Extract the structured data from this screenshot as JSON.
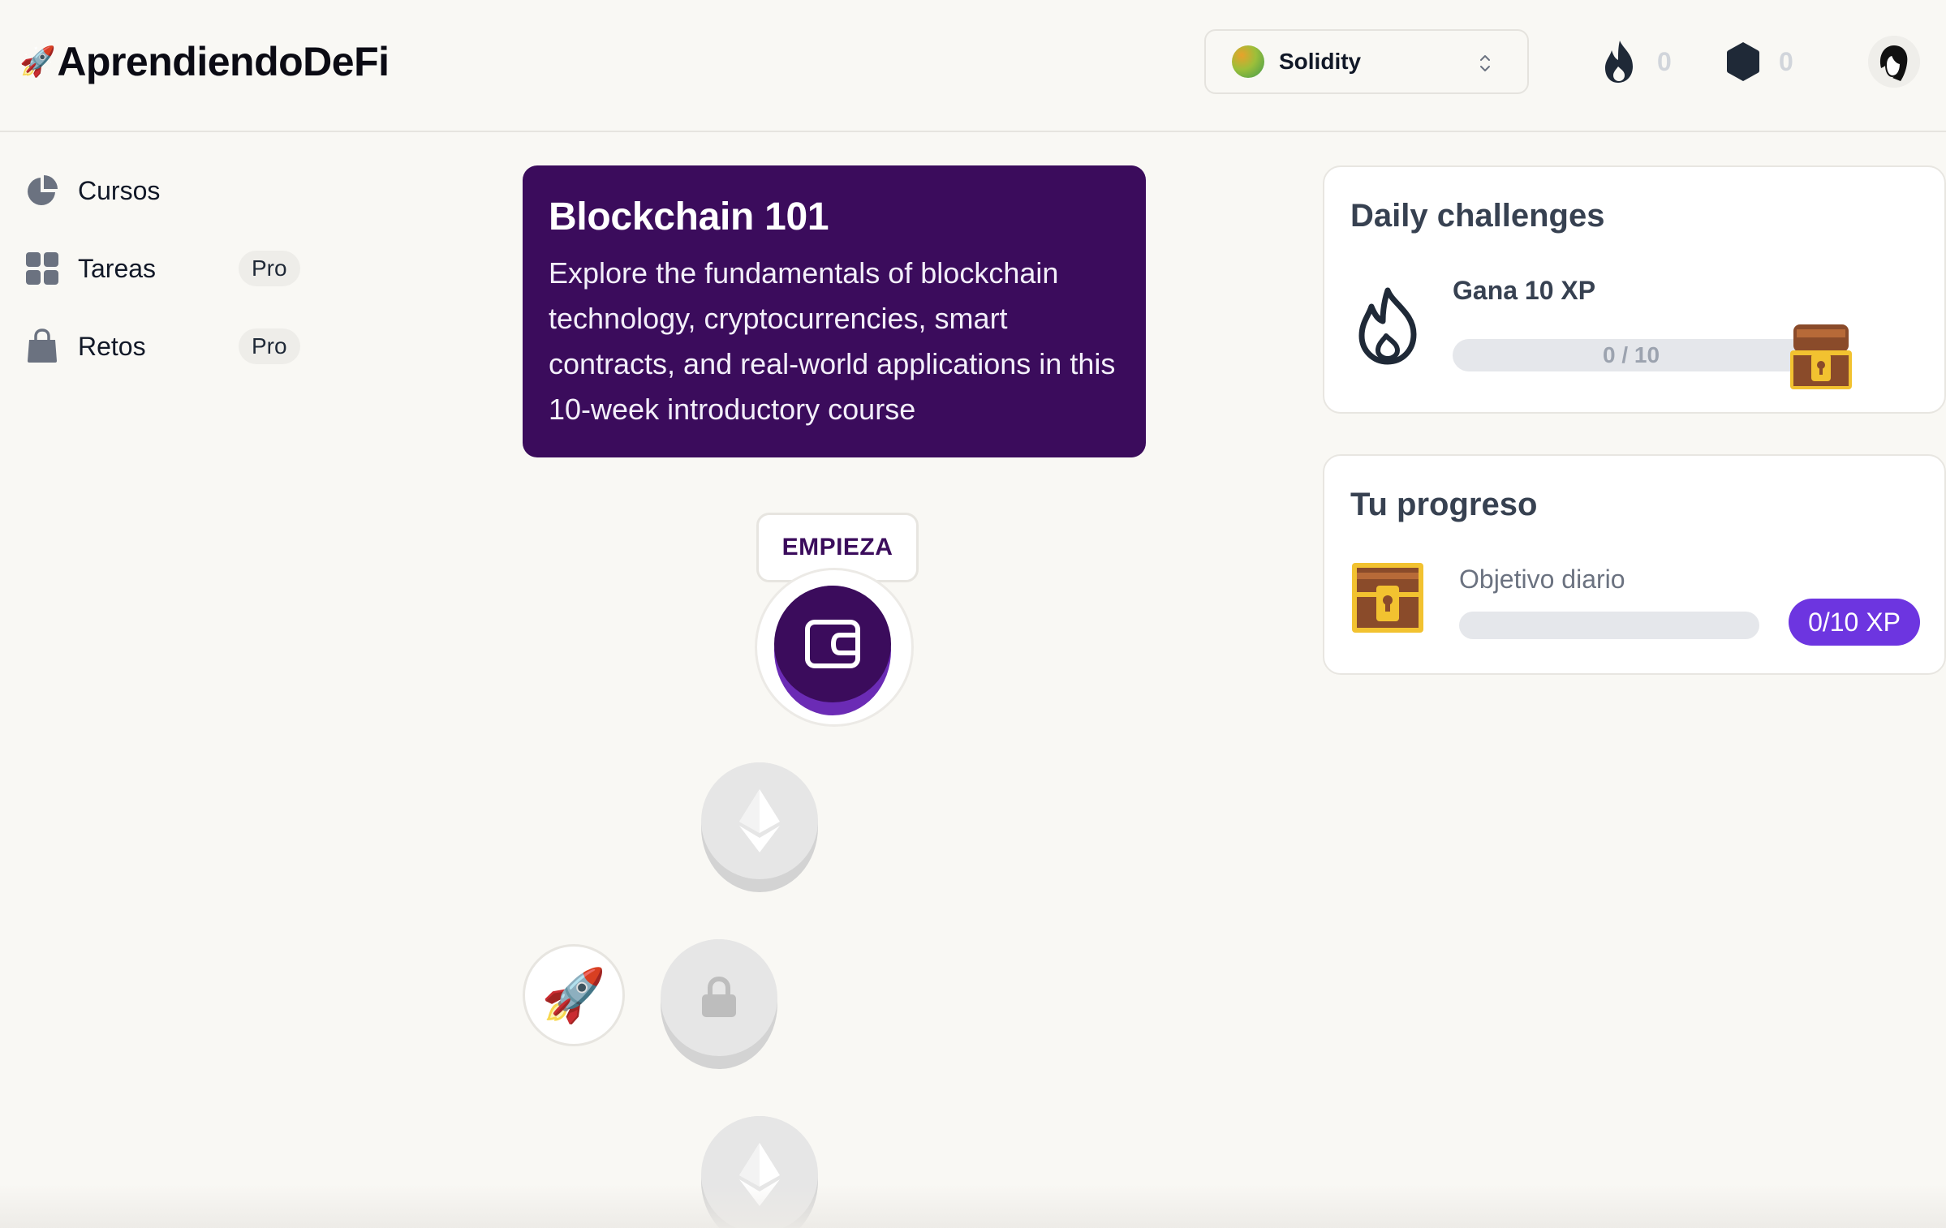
{
  "app": {
    "rocket_glyph": "🚀",
    "name": "AprendiendoDeFi"
  },
  "header": {
    "language_select": {
      "value": "Solidity"
    },
    "streak": {
      "count": "0",
      "icon": "flame-icon"
    },
    "gems": {
      "count": "0",
      "icon": "hexagon-icon"
    },
    "avatar": "user-avatar"
  },
  "sidebar": {
    "items": [
      {
        "label": "Cursos",
        "icon": "pie-chart-icon",
        "badge": ""
      },
      {
        "label": "Tareas",
        "icon": "grid-icon",
        "badge": "Pro"
      },
      {
        "label": "Retos",
        "icon": "shopping-bag-icon",
        "badge": "Pro"
      }
    ]
  },
  "course": {
    "title": "Blockchain 101",
    "description": "Explore the fundamentals of blockchain technology, cryptocurrencies, smart contracts, and real-world applications in this 10-week introductory course"
  },
  "path": {
    "start_label": "EMPIEZA",
    "rocket_glyph": "🚀",
    "nodes": [
      {
        "state": "active",
        "icon": "wallet-icon"
      },
      {
        "state": "locked",
        "icon": "ethereum-icon"
      },
      {
        "state": "locked",
        "icon": "lock-icon"
      },
      {
        "state": "locked",
        "icon": "ethereum-icon"
      }
    ]
  },
  "daily_challenges": {
    "title": "Daily challenges",
    "challenge": {
      "title": "Gana 10 XP",
      "progress_text": "0 / 10",
      "progress": 0
    }
  },
  "progress_card": {
    "title": "Tu progreso",
    "goal_label": "Objetivo diario",
    "goal_badge": "0/10 XP",
    "progress": 0
  },
  "colors": {
    "brand_purple": "#3b0c5c",
    "accent_violet": "#6d35e0",
    "background": "#f9f8f4"
  }
}
